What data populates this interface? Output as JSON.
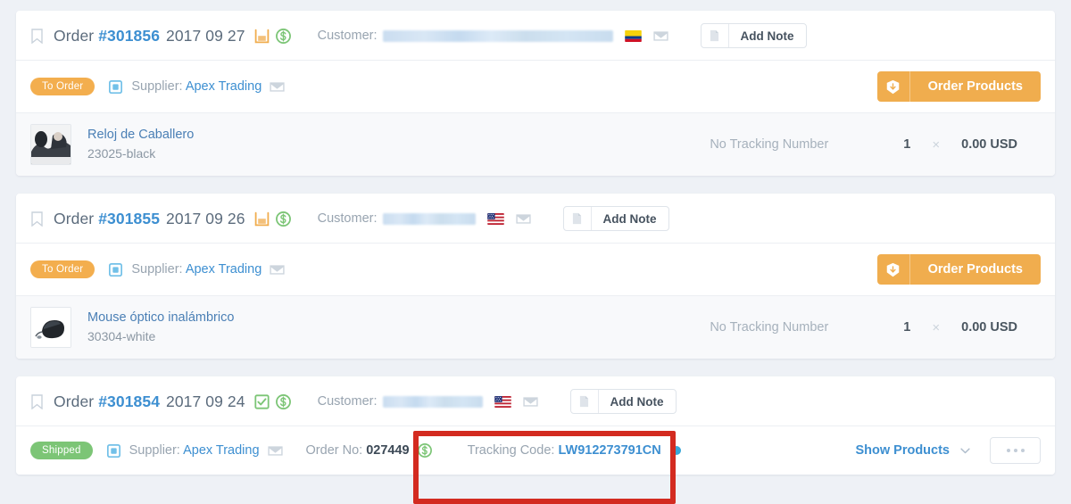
{
  "theme": {
    "page_bg": "#eef1f6",
    "card_bg": "#ffffff",
    "link_blue": "#3d8fd1",
    "orange": "#f0ad4e",
    "green": "#7cc576",
    "muted": "#98a4b0",
    "highlight_red": "#d32b20",
    "tracking_dot": "#3aa8d8"
  },
  "orders": [
    {
      "bookmark_icon": "bookmark-icon",
      "title_prefix": "Order",
      "number": "#301856",
      "date": "2017 09 27",
      "status_icon": "tray-icon",
      "status_icon_color": "#f0ad4e",
      "payment_icon": "dollar-circle-icon",
      "customer_label": "Customer:",
      "customer_value_redacted": true,
      "customer_redacted_width": 258,
      "flag": "colombia-flag-icon",
      "email_icon": "envelope-icon",
      "add_note_label": "Add Note",
      "supplier": {
        "badge": "To Order",
        "badge_type": "to-order",
        "icon": "supplier-icon",
        "label": "Supplier:",
        "name": "Apex Trading",
        "email_icon": "envelope-icon",
        "action_label": "Order Products",
        "action_icon": "ship-package-icon"
      },
      "products": [
        {
          "thumb": "watch-thumbnail",
          "name": "Reloj de Caballero",
          "sku": "23025-black",
          "tracking": "No Tracking Number",
          "qty": "1",
          "times": "×",
          "price": "0.00 USD"
        }
      ]
    },
    {
      "bookmark_icon": "bookmark-icon",
      "title_prefix": "Order",
      "number": "#301855",
      "date": "2017 09 26",
      "status_icon": "tray-icon",
      "status_icon_color": "#f0ad4e",
      "payment_icon": "dollar-circle-icon",
      "customer_label": "Customer:",
      "customer_value_redacted": true,
      "customer_redacted_width": 104,
      "flag": "usa-flag-icon",
      "email_icon": "envelope-icon",
      "add_note_label": "Add Note",
      "supplier": {
        "badge": "To Order",
        "badge_type": "to-order",
        "icon": "supplier-icon",
        "label": "Supplier:",
        "name": "Apex Trading",
        "email_icon": "envelope-icon",
        "action_label": "Order Products",
        "action_icon": "ship-package-icon"
      },
      "products": [
        {
          "thumb": "mouse-thumbnail",
          "name": "Mouse óptico inalámbrico",
          "sku": "30304-white",
          "tracking": "No Tracking Number",
          "qty": "1",
          "times": "×",
          "price": "0.00 USD"
        }
      ]
    },
    {
      "bookmark_icon": "bookmark-icon",
      "title_prefix": "Order",
      "number": "#301854",
      "date": "2017 09 24",
      "status_icon": "check-box-icon",
      "status_icon_color": "#7cc576",
      "payment_icon": "dollar-circle-icon",
      "customer_label": "Customer:",
      "customer_value_redacted": true,
      "customer_redacted_width": 112,
      "flag": "usa-flag-icon",
      "email_icon": "envelope-icon",
      "add_note_label": "Add Note",
      "shipped_row": {
        "badge": "Shipped",
        "badge_type": "shipped",
        "icon": "supplier-icon",
        "label": "Supplier:",
        "name": "Apex Trading",
        "email_icon": "envelope-icon",
        "order_no_label": "Order No:",
        "order_no_value": "027449",
        "order_no_icon": "dollar-circle-icon",
        "tracking_label": "Tracking Code:",
        "tracking_value": "LW912273791CN",
        "tracking_dot": "blue-dot-icon",
        "show_products_label": "Show Products",
        "chevron": "chevron-down-icon",
        "more_menu": "ellipsis-icon"
      }
    }
  ],
  "annotation": {
    "type": "red-highlight-box",
    "target": "tracking-code-field"
  }
}
